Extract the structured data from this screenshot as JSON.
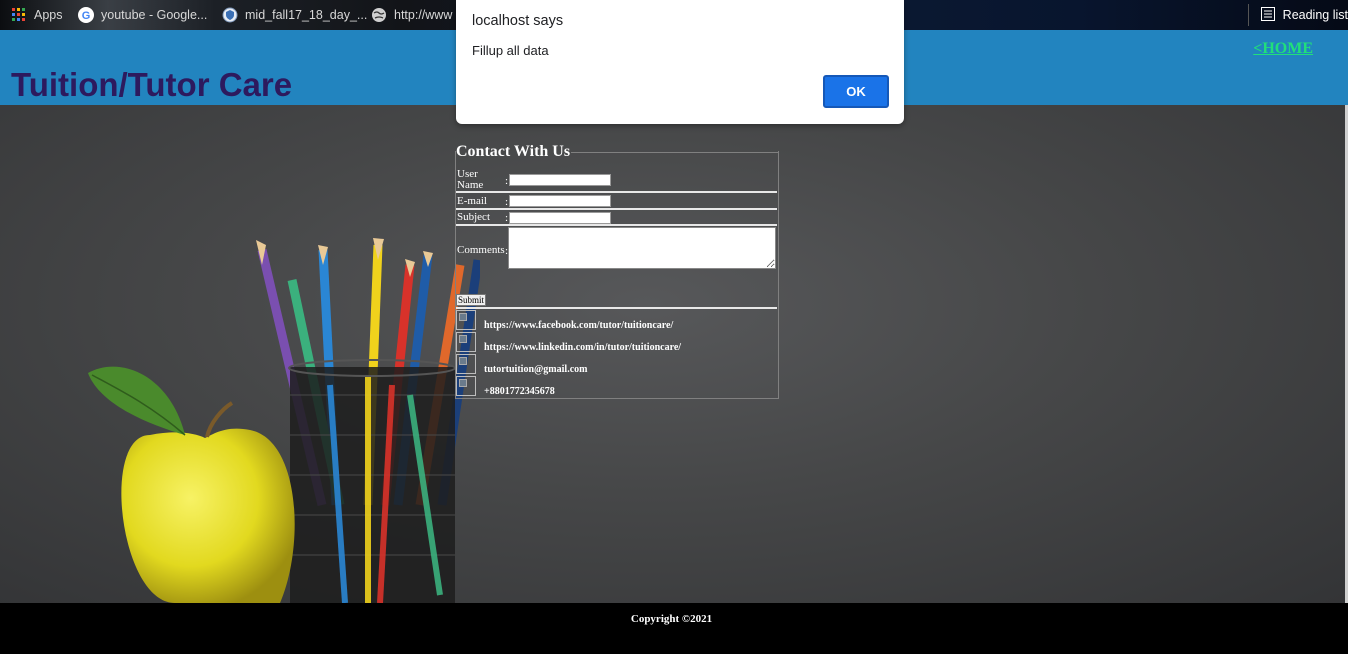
{
  "browser": {
    "bookmarks": [
      {
        "label": "Apps",
        "icon": "apps-grid-icon"
      },
      {
        "label": "youtube - Google...",
        "icon": "google-icon"
      },
      {
        "label": "mid_fall17_18_day_...",
        "icon": "shield-icon"
      },
      {
        "label": "http://www",
        "icon": "globe-icon"
      }
    ],
    "reading_list": "Reading list"
  },
  "header": {
    "title": "Tuition/Tutor Care",
    "home_link": "<HOME"
  },
  "contact": {
    "legend": "Contact With Us",
    "fields": [
      {
        "label": "User Name",
        "value": ""
      },
      {
        "label": "E-mail",
        "value": ""
      },
      {
        "label": "Subject",
        "value": ""
      },
      {
        "label": "Comments",
        "value": ""
      }
    ],
    "submit_label": "Submit",
    "social": [
      "https://www.facebook.com/tutor/tuitioncare/",
      "https://www.linkedin.com/in/tutor/tuitioncare/",
      "tutortuition@gmail.com",
      "+8801772345678"
    ]
  },
  "footer": {
    "copyright": "Copyright ©2021"
  },
  "dialog": {
    "title": "localhost says",
    "message": "Fillup all data",
    "ok_label": "OK"
  },
  "colors": {
    "header_bg": "#2284bf",
    "title_color": "#2d1a5e",
    "home_link_color": "#20e07a",
    "ok_button": "#1a73e8"
  }
}
